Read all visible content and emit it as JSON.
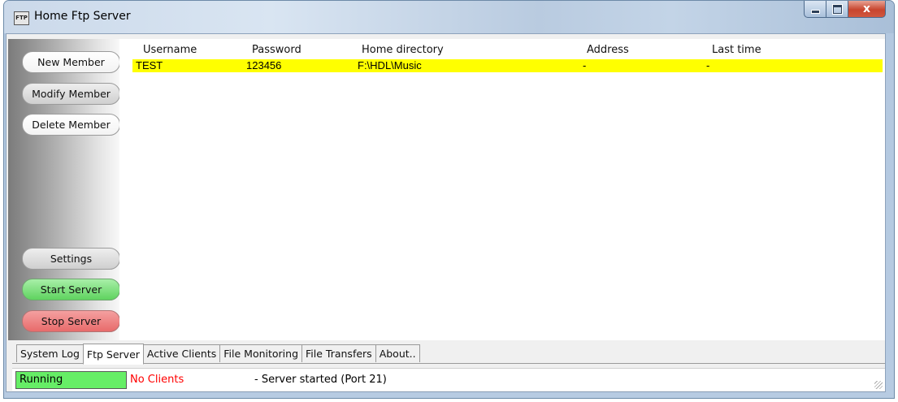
{
  "window": {
    "title": "Home Ftp Server",
    "icon_text": "FTP",
    "close_label": "x"
  },
  "sidebar": {
    "new_member": "New Member",
    "modify_member": "Modify Member",
    "delete_member": "Delete Member",
    "settings": "Settings",
    "start_server": "Start Server",
    "stop_server": "Stop Server"
  },
  "members": {
    "columns": [
      "Username",
      "Password",
      "Home directory",
      "Address",
      "Last time"
    ],
    "rows": [
      {
        "username": "TEST",
        "password": "123456",
        "home_directory": "F:\\HDL\\Music",
        "address": "-",
        "last_time": "-",
        "selected": true
      }
    ]
  },
  "tabs": [
    "System Log",
    "Ftp Server",
    "Active Clients",
    "File Monitoring",
    "File Transfers",
    "About.."
  ],
  "active_tab": "Ftp Server",
  "status": {
    "state": "Running",
    "clients": "No Clients",
    "message": "- Server started (Port 21)"
  },
  "colors": {
    "selected_row": "#ffff00",
    "running": "#66ee66",
    "no_clients": "#ff0000",
    "start_server": "#7ee07e",
    "stop_server": "#ee7a7a"
  }
}
